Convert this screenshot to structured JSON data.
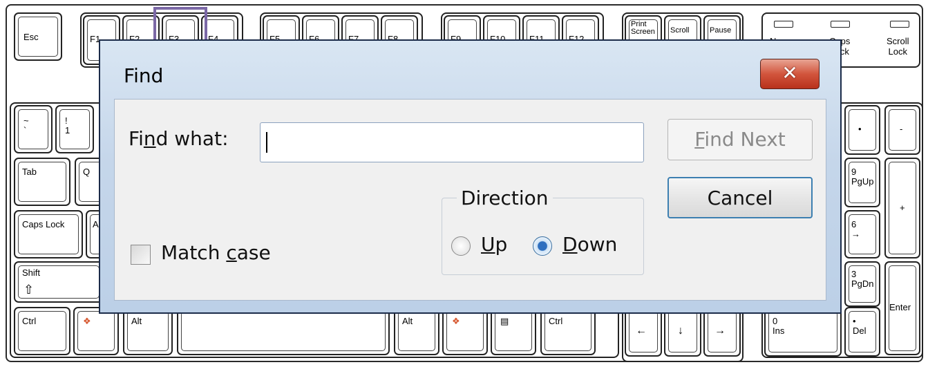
{
  "keyboard": {
    "keys": {
      "esc": "Esc",
      "f1": "F1",
      "f2": "F2",
      "f3": "F3",
      "f4": "F4",
      "f5": "F5",
      "f6": "F6",
      "f7": "F7",
      "f8": "F8",
      "f9": "F9",
      "f10": "F10",
      "f11": "F11",
      "f12": "F12",
      "print_screen": "Print\nScreen",
      "scroll": "Scroll",
      "pause": "Pause",
      "tilde": "~\n`",
      "one": "!\n1",
      "tab": "Tab",
      "q": "Q",
      "caps_lock": "Caps Lock",
      "a": "A",
      "shift": "Shift",
      "shift_arrow": "⇧",
      "ctrl_left": "Ctrl",
      "alt_left": "Alt",
      "alt_right": "Alt",
      "ctrl_right": "Ctrl",
      "arrow_left": "←",
      "arrow_down": "↓",
      "arrow_right": "→",
      "num_dot_top": "•",
      "num_minus": "-",
      "num_9": "9\nPgUp",
      "num_plus": "+",
      "num_6": "6\n→",
      "num_3": "3\nPgDn",
      "enter": "Enter",
      "num_0": "0\nIns",
      "num_del": "•\nDel"
    },
    "leds": {
      "num": "Num",
      "caps": "Caps\nLock",
      "scroll": "Scroll\nLock"
    }
  },
  "dialog": {
    "title": "Find",
    "close_glyph": "✕",
    "find_what_label_pre": "Fi",
    "find_what_label_ul": "n",
    "find_what_label_post": "d what:",
    "find_what_value": "",
    "find_next_pre": "",
    "find_next_ul": "F",
    "find_next_post": "ind Next",
    "cancel_label": "Cancel",
    "direction_legend": "Direction",
    "up_ul": "U",
    "up_post": "p",
    "down_ul": "D",
    "down_post": "own",
    "direction_selected": "Down",
    "match_case_pre": "Match ",
    "match_case_ul": "c",
    "match_case_post": "ase",
    "match_case_checked": false
  },
  "colors": {
    "dialog_frame": "#1b2b49",
    "close_button": "#d2553d",
    "highlight_f3": "#7b68a6"
  }
}
